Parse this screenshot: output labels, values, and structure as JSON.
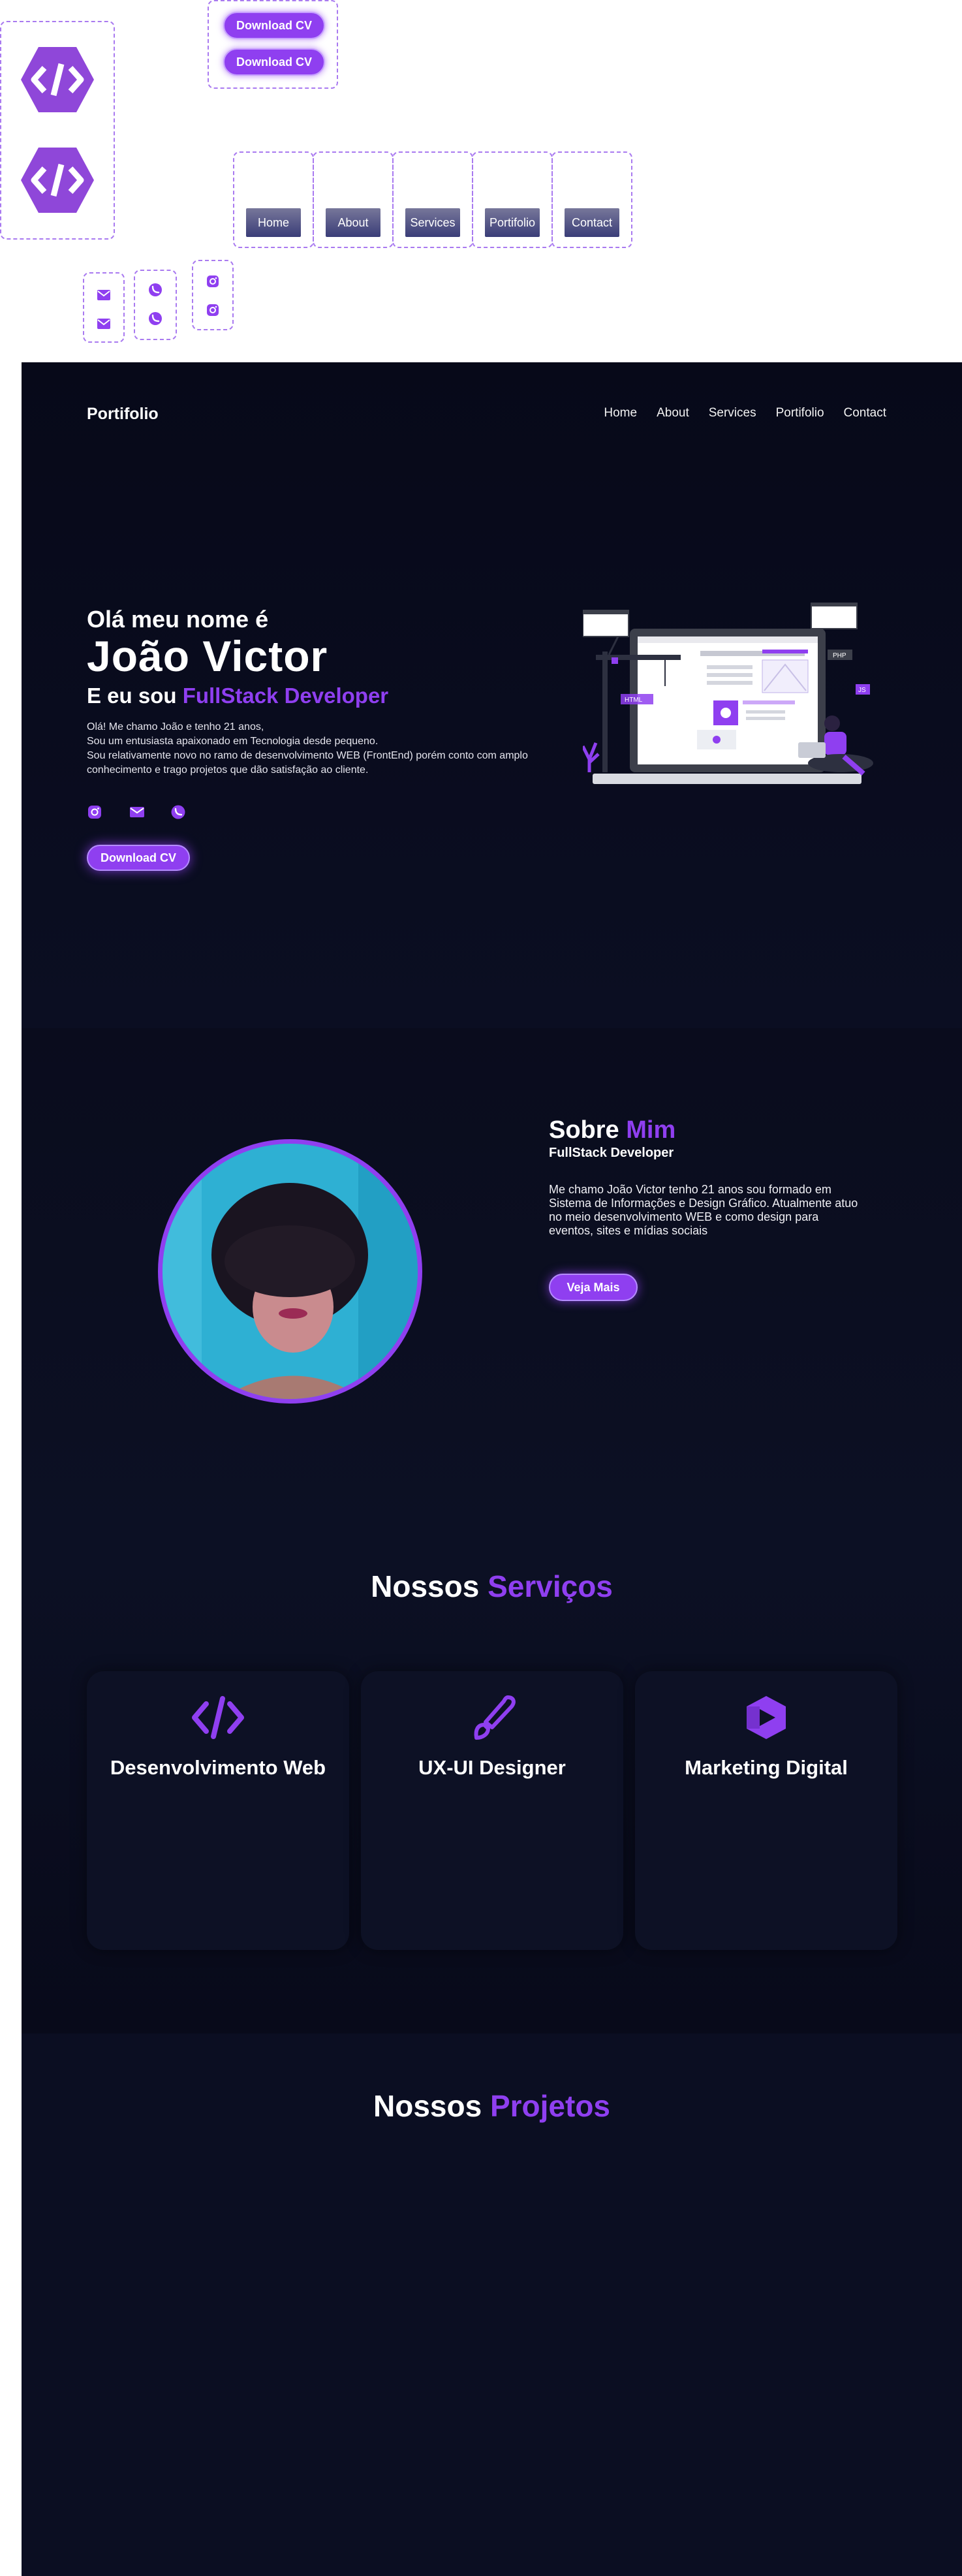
{
  "components": {
    "download_cv_labels": [
      "Download CV",
      "Download CV"
    ],
    "nav_buttons": [
      "Home",
      "About",
      "Services",
      "Portifolio",
      "Contact"
    ]
  },
  "header": {
    "brand": "Portifolio",
    "nav": [
      "Home",
      "About",
      "Services",
      "Portifolio",
      "Contact"
    ]
  },
  "hero": {
    "greeting": "Olá meu nome é",
    "name": "João Victor",
    "role_prefix": "E eu sou ",
    "role_accent": "FullStack Developer",
    "description": [
      "Olá! Me chamo João e tenho 21 anos,",
      "Sou um entusiasta apaixonado em Tecnologia desde pequeno.",
      "Sou relativamente novo no ramo de desenvolvimento WEB (FrontEnd) porém conto com amplo conhecimento e trago projetos que dão satisfação ao cliente."
    ],
    "social_icons": [
      "instagram-icon",
      "email-icon",
      "whatsapp-icon"
    ],
    "cta": "Download CV",
    "illustration_labels": {
      "html": "HTML",
      "php": "PHP",
      "js": "JS"
    }
  },
  "about": {
    "title_white": "Sobre ",
    "title_accent": "Mim",
    "subtitle": "FullStack Developer",
    "text": "Me chamo João Victor tenho 21 anos sou formado em Sistema de Informações e Design Gráfico. Atualmente atuo no meio desenvolvimento WEB e como design para eventos, sites e mídias sociais",
    "cta": "Veja Mais"
  },
  "services": {
    "title_white": "Nossos ",
    "title_accent": "Serviços",
    "cards": [
      {
        "icon": "code-icon",
        "label": "Desenvolvimento Web"
      },
      {
        "icon": "brush-icon",
        "label": "UX-UI Designer"
      },
      {
        "icon": "marketing-icon",
        "label": "Marketing Digital"
      }
    ]
  },
  "projects": {
    "title_white": "Nossos ",
    "title_accent": "Projetos"
  },
  "colors": {
    "accent": "#8f3ff0",
    "background": "#0a0c1d",
    "nav_button_gradient_top": "#77779a",
    "nav_button_gradient_bottom": "#3a3d78"
  }
}
